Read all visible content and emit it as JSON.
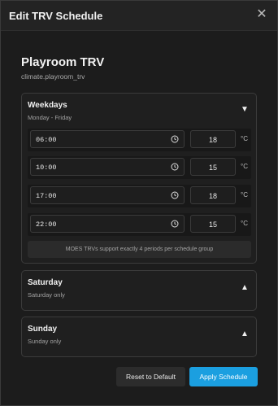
{
  "dialog": {
    "title": "Edit TRV Schedule",
    "close_icon": "close-icon"
  },
  "device": {
    "name": "Playroom TRV",
    "entity_id": "climate.playroom_trv"
  },
  "groups": [
    {
      "title": "Weekdays",
      "subtitle": "Monday - Friday",
      "expanded": true,
      "toggle_icon": "triangle-down-icon",
      "periods": [
        {
          "time": "06:00",
          "temp": "18",
          "unit": "°C"
        },
        {
          "time": "10:00",
          "temp": "15",
          "unit": "°C"
        },
        {
          "time": "17:00",
          "temp": "18",
          "unit": "°C"
        },
        {
          "time": "22:00",
          "temp": "15",
          "unit": "°C"
        }
      ],
      "note": "MOES TRVs support exactly 4 periods per schedule group"
    },
    {
      "title": "Saturday",
      "subtitle": "Saturday only",
      "expanded": false,
      "toggle_icon": "triangle-up-icon"
    },
    {
      "title": "Sunday",
      "subtitle": "Sunday only",
      "expanded": false,
      "toggle_icon": "triangle-up-icon"
    }
  ],
  "actions": {
    "reset_label": "Reset to Default",
    "apply_label": "Apply Schedule"
  },
  "colors": {
    "accent": "#1b9fe0",
    "background": "#1c1c1c"
  }
}
